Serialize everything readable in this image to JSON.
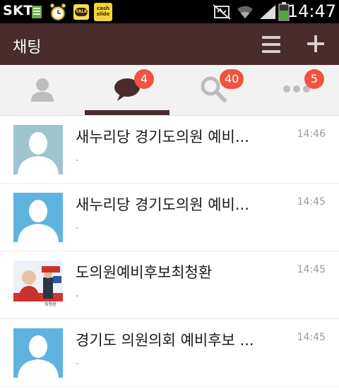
{
  "status_bar": {
    "carrier": "SKT",
    "time": "14:47",
    "icons": [
      "sim-icon",
      "alarm-clock-icon",
      "kakaotalk-talk-icon",
      "cash-slide-icon",
      "mute-icon",
      "wifi-icon",
      "signal-icon",
      "battery-icon"
    ],
    "talk_label": "TALK",
    "cash_slide_label": "cash slide"
  },
  "app_bar": {
    "title": "채팅",
    "background": "#4a2c2c"
  },
  "tabs": [
    {
      "name": "friends",
      "icon": "person-icon",
      "badge": ""
    },
    {
      "name": "chats",
      "icon": "chat-bubble-icon",
      "badge": "4",
      "active": true
    },
    {
      "name": "search",
      "icon": "magnifier-icon",
      "badge": "40"
    },
    {
      "name": "more",
      "icon": "more-dots-icon",
      "badge": "5"
    }
  ],
  "chats": [
    {
      "name": "새누리당 경기도의원 예비...",
      "message": ".",
      "time": "14:46",
      "avatar": "default-avatar-gray"
    },
    {
      "name": "새누리당 경기도의원 예비...",
      "message": ".",
      "time": "14:45",
      "avatar": "default-avatar-blue"
    },
    {
      "name": "도의원예비후보최청환",
      "message": ".",
      "time": "14:45",
      "avatar": "campaign-photo",
      "avatar_caption": "최청환"
    },
    {
      "name": "경기도 의원의회 예비후보 ...",
      "message": ".",
      "time": "14:45",
      "avatar": "default-avatar-blue"
    }
  ],
  "colors": {
    "accent": "#4a2c2c",
    "badge": "#f0533f",
    "avatar_blue": "#5fb3e0",
    "avatar_gray": "#9fc3cf"
  }
}
